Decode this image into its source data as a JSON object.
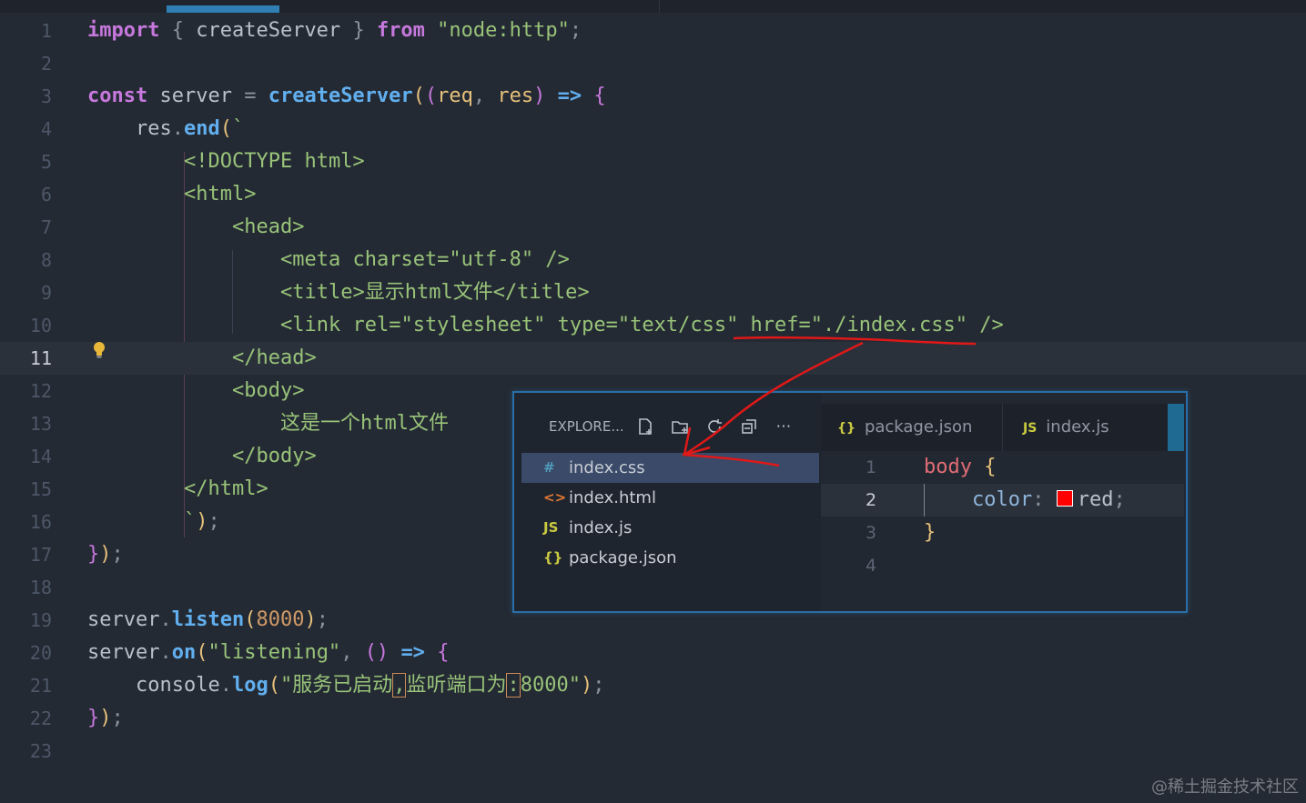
{
  "code_lines": [
    {
      "n": "1"
    },
    {
      "n": "2"
    },
    {
      "n": "3"
    },
    {
      "n": "4"
    },
    {
      "n": "5"
    },
    {
      "n": "6"
    },
    {
      "n": "7"
    },
    {
      "n": "8"
    },
    {
      "n": "9"
    },
    {
      "n": "10"
    },
    {
      "n": "11"
    },
    {
      "n": "12"
    },
    {
      "n": "13"
    },
    {
      "n": "14"
    },
    {
      "n": "15"
    },
    {
      "n": "16"
    },
    {
      "n": "17"
    },
    {
      "n": "18"
    },
    {
      "n": "19"
    },
    {
      "n": "20"
    },
    {
      "n": "21"
    },
    {
      "n": "22"
    },
    {
      "n": "23"
    }
  ],
  "tokens": {
    "import": "import",
    "createServer": "createServer",
    "from": "from",
    "node_http": "\"node:http\"",
    "const": "const",
    "server": "server",
    "req": "req",
    "res": "res",
    "end": "end",
    "doctype": "<!DOCTYPE html>",
    "html_open": "<html>",
    "head_open": "<head>",
    "meta": "<meta charset=\"utf-8\" />",
    "title": "<title>显示html文件</title>",
    "link": "<link rel=\"stylesheet\" type=\"text/css\" href=\"./index.css\" />",
    "head_close": "</head>",
    "body_open": "<body>",
    "body_text": "这是一个html文件",
    "body_close": "</body>",
    "html_close": "</html>",
    "listen": "listen",
    "port": "8000",
    "on": "on",
    "listening": "\"listening\"",
    "console": "console",
    "log": "log",
    "log_str_a": "\"服务已启动",
    "log_comma": ",",
    "log_str_b": "监听端口为",
    "log_colon": ":",
    "log_str_c": "8000\""
  },
  "popup": {
    "explorer_title": "EXPLORE...",
    "files": [
      {
        "icon": "#",
        "name": "index.css",
        "color": "#519aba"
      },
      {
        "icon": "<>",
        "name": "index.html",
        "color": "#e37933"
      },
      {
        "icon": "JS",
        "name": "index.js",
        "color": "#cbcb41"
      },
      {
        "icon": "{}",
        "name": "package.json",
        "color": "#cbcb41"
      }
    ],
    "tabs": [
      {
        "icon": "{}",
        "name": "package.json",
        "color": "#cbcb41"
      },
      {
        "icon": "JS",
        "name": "index.js",
        "color": "#cbcb41"
      }
    ],
    "css_lines": [
      "1",
      "2",
      "3",
      "4"
    ],
    "css": {
      "selector": "body",
      "open": "{",
      "prop": "color",
      "value": "red",
      "close": "}"
    }
  },
  "watermark": "@稀土掘金技术社区",
  "colors": {
    "swatch": "#ff0000",
    "annotation": "#e01818"
  }
}
